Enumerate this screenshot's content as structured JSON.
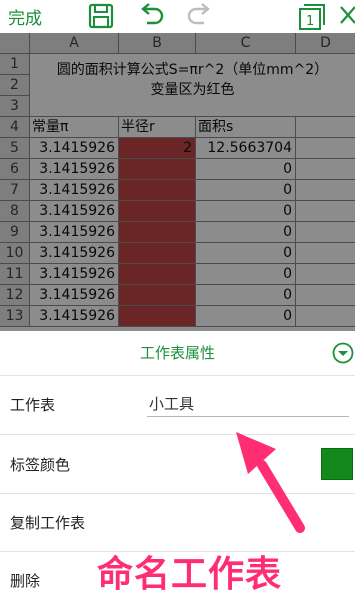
{
  "toolbar": {
    "done_label": "完成",
    "sheet_badge": "1",
    "icons": [
      "save-icon",
      "undo-icon",
      "redo-icon",
      "sheet-icon",
      "close-icon"
    ]
  },
  "sheet": {
    "columns": [
      "A",
      "B",
      "C",
      "D"
    ],
    "rows": [
      "1",
      "2",
      "3",
      "4",
      "5",
      "6",
      "7",
      "8",
      "9",
      "10",
      "11",
      "12",
      "13"
    ],
    "title_line1": "圆的面积计算公式S=πr^2（单位mm^2）",
    "title_line2": "变量区为红色",
    "header_a": "常量π",
    "header_b": "半径r",
    "header_c": "面积s",
    "data_rows": [
      {
        "a": "3.1415926",
        "b": "2",
        "c": "12.5663704"
      },
      {
        "a": "3.1415926",
        "b": "",
        "c": "0"
      },
      {
        "a": "3.1415926",
        "b": "",
        "c": "0"
      },
      {
        "a": "3.1415926",
        "b": "",
        "c": "0"
      },
      {
        "a": "3.1415926",
        "b": "",
        "c": "0"
      },
      {
        "a": "3.1415926",
        "b": "",
        "c": "0"
      },
      {
        "a": "3.1415926",
        "b": "",
        "c": "0"
      },
      {
        "a": "3.1415926",
        "b": "",
        "c": "0"
      },
      {
        "a": "3.1415926",
        "b": "",
        "c": "0"
      }
    ],
    "variable_color": "#c24646"
  },
  "panel": {
    "title": "工作表属性",
    "collapse_icon": "chevron-down-circle-icon",
    "sheet_label": "工作表",
    "sheet_name_value": "小工具",
    "tab_color_label": "标签颜色",
    "tab_color": "#13891c",
    "copy_label": "复制工作表",
    "delete_label": "删除"
  },
  "annotation": {
    "text": "命名工作表",
    "color": "#ff2e73"
  },
  "colors": {
    "accent": "#1b8f3a"
  }
}
